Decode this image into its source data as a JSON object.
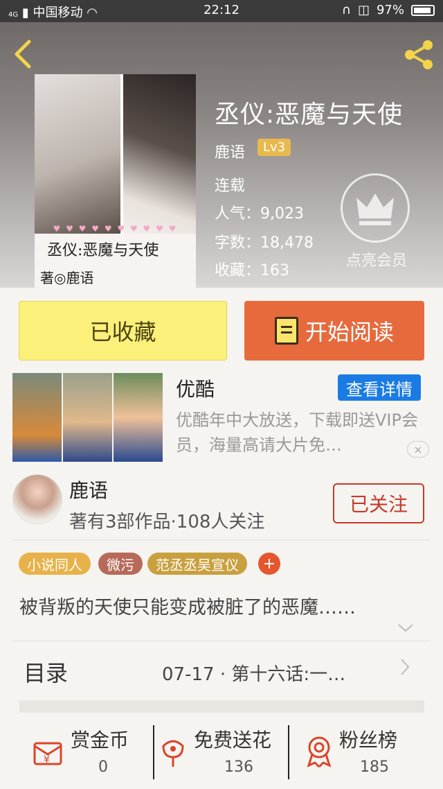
{
  "status_bar": {
    "carrier": "中国移动",
    "network": "4G",
    "time": "22:12",
    "battery": "97%"
  },
  "book": {
    "title": "丞仪:恶魔与天使",
    "author": "鹿语",
    "level": "Lv3",
    "status": "连载",
    "popularity_label": "人气：",
    "popularity": "9,023",
    "words_label": "字数：",
    "words": "18,478",
    "favorites_label": "收藏：",
    "favorites": "163",
    "cover_title": "丞仪:恶魔与天使",
    "cover_author": "著◎鹿语"
  },
  "vip": {
    "label": "点亮会员"
  },
  "actions": {
    "favorite": "已收藏",
    "read": "开始阅读"
  },
  "ad": {
    "title": "优酷",
    "button": "查看详情",
    "description": "优酷年中大放送，下载即送VIP会员，海量高请大片免…",
    "close": "×"
  },
  "author_card": {
    "name": "鹿语",
    "meta": "著有3部作品·108人关注",
    "follow": "已关注"
  },
  "tags": [
    {
      "label": "小说同人",
      "color": "#e8b24a"
    },
    {
      "label": "微污",
      "color": "#b86a5a"
    },
    {
      "label": "范丞丞吴宣仪",
      "color": "#c9a03f"
    }
  ],
  "tag_add": "+",
  "summary": "被背叛的天使只能变成被脏了的恶魔……",
  "toc": {
    "label": "目录",
    "latest": "07-17 · 第十六话:一…"
  },
  "bottom": [
    {
      "label": "赏金币",
      "value": "0",
      "icon": "coin-icon"
    },
    {
      "label": "免费送花",
      "value": "136",
      "icon": "flower-icon"
    },
    {
      "label": "粉丝榜",
      "value": "185",
      "icon": "medal-icon"
    }
  ],
  "colors": {
    "accent": "#e76a3d",
    "favorite_bg": "#fbf07a",
    "follow": "#c7392a",
    "ad_button": "#1b7be4"
  }
}
